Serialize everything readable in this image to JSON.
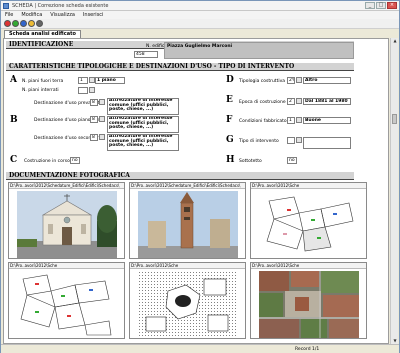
{
  "window": {
    "title": "SCHEDA | Correzione scheda esistente",
    "controls": [
      "_",
      "□",
      "×"
    ]
  },
  "menu": [
    "File",
    "Modifica",
    "Visualizza",
    "Inserisci"
  ],
  "toolbar": {
    "buttons": [
      {
        "name": "record-first-icon",
        "color": "#dd3333"
      },
      {
        "name": "record-prev-icon",
        "color": "#33aa33"
      },
      {
        "name": "record-next-icon",
        "color": "#3366cc"
      },
      {
        "name": "record-last-icon",
        "color": "#eebb33"
      },
      {
        "name": "record-delete-icon",
        "color": "#666666"
      }
    ]
  },
  "tab": {
    "label": "Scheda analisi edificato"
  },
  "identification": {
    "title": "IDENTIFICAZIONE",
    "edificio_label": "N. edificio",
    "edificio_value": "458",
    "address": "Piazza Guglielmo Marconi"
  },
  "characteristics": {
    "title": "CARATTERISTICHE TIPOLOGICHE E DESTINAZIONI D'USO - TIPO DI INTERVENTO",
    "left": {
      "A": {
        "letter": "A",
        "piani_fuori_label": "N. piani fuori terra",
        "piani_fuori_value": "1",
        "piani_fuori_desc": "1 piano",
        "piani_interrati_label": "N. piani interrati"
      },
      "B": {
        "letter": "B",
        "prevalente_label": "Destinazione d'uso prevalente",
        "prevalente_code": "8",
        "prevalente_text": "Attrezzature di interesse comune (uffici pubblici, poste, chiese, ...)",
        "piano_label": "Destinazione d'uso piano terra",
        "piano_code": "8",
        "piano_text": "Attrezzature di interesse comune (uffici pubblici, poste, chiese, ...)",
        "secondaria_label": "Destinazione d'uso secondaria",
        "secondaria_code": "8",
        "secondaria_text": "Attrezzature di interesse comune (uffici pubblici, poste, chiese, ...)"
      },
      "C": {
        "letter": "C",
        "costruzione_label": "Costruzione in corso",
        "costruzione_value": "no"
      }
    },
    "right": {
      "D": {
        "letter": "D",
        "label": "Tipologia costruttiva",
        "code": "2%",
        "value": "Altro"
      },
      "E": {
        "letter": "E",
        "label": "Epoca di costruzione",
        "code": "2",
        "value": "Dal 1881 al 1980"
      },
      "F": {
        "letter": "F",
        "label": "Condizioni fabbricato",
        "code": "1",
        "value": "Buone"
      },
      "G": {
        "letter": "G",
        "label": "Tipo di intervento",
        "code": "",
        "value": ""
      },
      "H": {
        "letter": "H",
        "label": "Sottotetto",
        "value": "no"
      }
    }
  },
  "documentation": {
    "title": "DOCUMENTAZIONE FOTOGRAFICA",
    "photos": [
      {
        "path": "D:\\Pro..avori\\2012\\Schedature_Edifici\\Edifici\\Schedacs\\",
        "kind": "photo-church-facade"
      },
      {
        "path": "D:\\Pro..avori\\2012\\Schedature_Edifici\\Edifici\\Schedacs\\",
        "kind": "photo-bell-tower"
      },
      {
        "path": "D:\\Pro..avori\\2012\\Sche",
        "kind": "map-cadastral"
      },
      {
        "path": "D:\\Pro..avori\\2012\\Sche",
        "kind": "map-cadastral"
      },
      {
        "path": "D:\\Pro..avori\\2012\\Sche",
        "kind": "map-urban-plan"
      },
      {
        "path": "D:\\Pro..avori\\2012\\Sche",
        "kind": "aerial-photo"
      }
    ]
  },
  "status": {
    "record": "Record 1/1"
  },
  "colors": {
    "section_bg": "#d3d3d3",
    "chrome": "#ece9d8",
    "window_border": "#7a96b8"
  }
}
